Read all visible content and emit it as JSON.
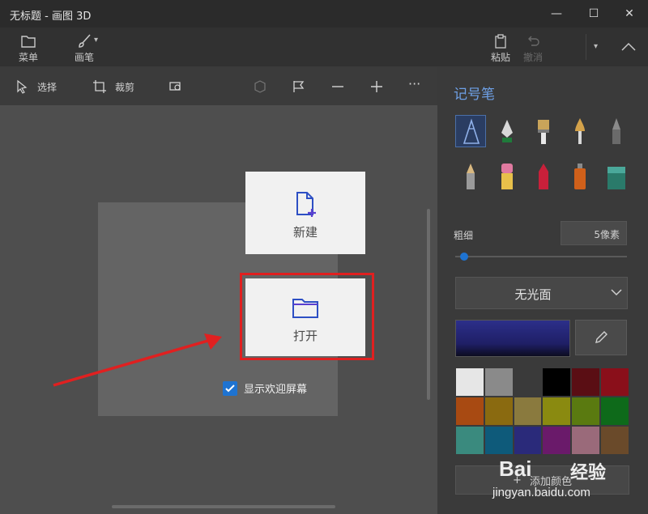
{
  "window": {
    "title": "无标题 - 画图 3D",
    "minimize": "—",
    "maximize": "☐",
    "close": "✕"
  },
  "menubar": {
    "menu_label": "菜单",
    "brushes_label": "画笔",
    "paste_label": "粘贴",
    "undo_label": "撤消"
  },
  "toolbar": {
    "select_label": "选择",
    "crop_label": "裁剪",
    "more": "···"
  },
  "welcome": {
    "new_label": "新建",
    "open_label": "打开",
    "show_welcome_label": "显示欢迎屏幕",
    "show_welcome_checked": true
  },
  "panel": {
    "title": "记号笔",
    "thickness_label": "粗细",
    "thickness_value": "5像素",
    "finish_value": "无光面",
    "add_color_label": "添加颜色",
    "palette": [
      "#e6e6e6",
      "#8a8a8a",
      "#3a3a3a",
      "#000000",
      "#5a0e14",
      "#8a0f1a",
      "#a84a12",
      "#8a6a10",
      "#8a7a3e",
      "#8a8a10",
      "#5a7a10",
      "#0e6a1a",
      "#3a8a7e",
      "#0e5a7a",
      "#2a2a7a",
      "#6a1a6a",
      "#9a6a7a",
      "#6a4a2a"
    ],
    "brushes": [
      "marker-icon",
      "calligraphy-pen-icon",
      "oil-brush-icon",
      "watercolor-icon",
      "pixel-pen-icon",
      "pencil-icon",
      "eraser-icon",
      "crayon-icon",
      "spray-can-icon",
      "fill-bucket-icon"
    ]
  },
  "accent": "#1e73d1",
  "highlight_color": "#e02020",
  "watermark": {
    "logo": "Bai",
    "brand": "经验",
    "url": "jingyan.baidu.com"
  }
}
